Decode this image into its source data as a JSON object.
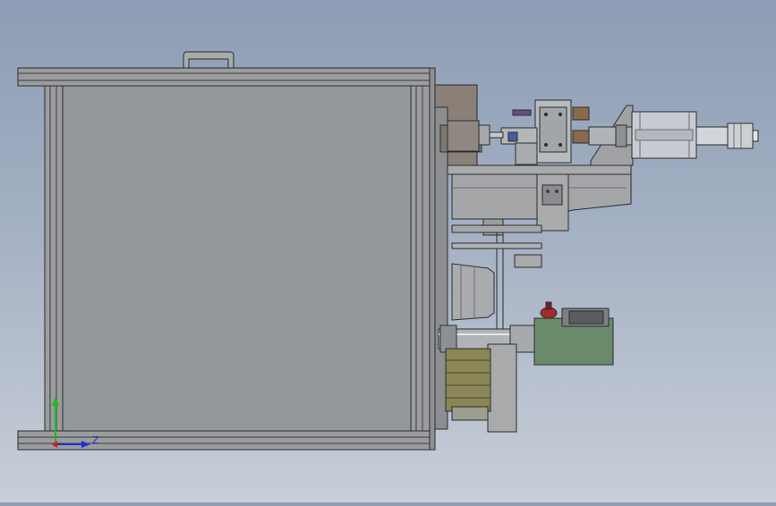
{
  "view": {
    "kind": "cad-assembly-front-view",
    "background_top": "#8d9db5",
    "background_bottom": "#c8ced8"
  },
  "colors": {
    "frame_fill": "#9a9c9e",
    "frame_stroke": "#2a2c30",
    "panel_fill": "#94989b",
    "motor_fill": "#c8ccd2",
    "gearbox_green": "#6b8a6a",
    "knob_red": "#a52a2a",
    "axis_x": "#d81b1b",
    "axis_y": "#1fb81f",
    "axis_z": "#1b32d8"
  },
  "triad": {
    "z_label": "Z",
    "x_icon": "axis-x-arrow",
    "y_icon": "axis-y-arrow",
    "z_icon": "axis-z-arrow"
  },
  "components": [
    "handle",
    "enclosure-frame",
    "enclosure-panel",
    "mounting-plate",
    "cylinder-actuator",
    "valve-block",
    "servo-motor",
    "drive-coupling",
    "support-bracket",
    "guide-plate",
    "pulley-housing",
    "roller-shaft",
    "gear-reducer",
    "indexing-wheel"
  ]
}
